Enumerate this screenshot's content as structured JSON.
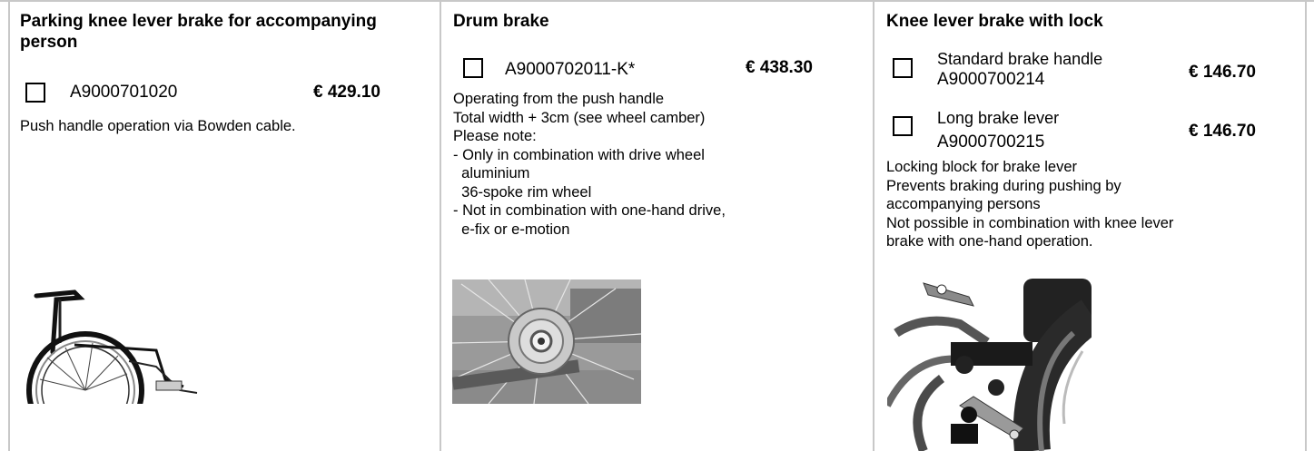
{
  "columns": [
    {
      "heading": "Parking knee lever brake for accompanying person",
      "option": {
        "code": "A9000701020",
        "price": "€ 429.10"
      },
      "description": "Push handle operation via Bowden cable.",
      "image": "wheelchair-side-view-image"
    },
    {
      "heading": "Drum brake",
      "option": {
        "code": "A9000702011-K*",
        "price": "€ 438.30"
      },
      "description_lines": [
        "Operating from the push handle",
        "Total width + 3cm (see wheel camber)",
        "Please note:",
        "- Only in combination with drive wheel",
        "  aluminium",
        "  36-spoke rim wheel",
        "- Not in combination with one-hand drive,",
        "  e-fix or e-motion"
      ],
      "image": "drum-brake-hub-image"
    },
    {
      "heading": "Knee lever brake with lock",
      "options": [
        {
          "name": "Standard brake handle",
          "code": "A9000700214",
          "price": "€ 146.70"
        },
        {
          "name": "Long brake lever",
          "code": "A9000700215",
          "price": "€ 146.70"
        }
      ],
      "description_lines": [
        "Locking block for brake lever",
        "Prevents braking during pushing by",
        "accompanying persons",
        "Not possible in combination with knee lever",
        "brake with one-hand operation."
      ],
      "image": "knee-lever-brake-lock-image"
    }
  ]
}
